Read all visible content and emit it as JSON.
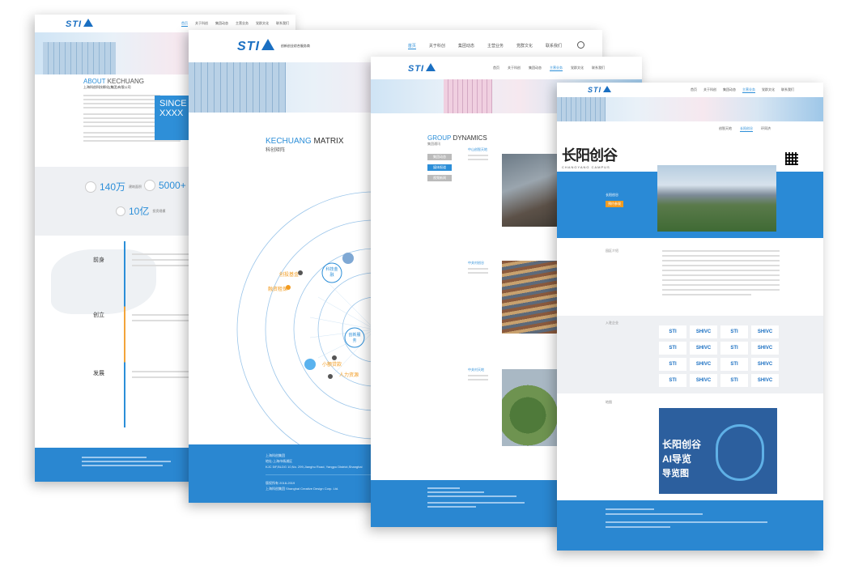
{
  "page1": {
    "logo": "STI",
    "nav": [
      "首页",
      "关于科创",
      "集团动态",
      "主营业务",
      "党群文化",
      "联系我们"
    ],
    "about_title": "ABOUT",
    "about_title2": "KECHUANG",
    "about_cn": "上海科创科技孵化(集团)有限公司",
    "since": "SINCE",
    "since_year": "XXXX",
    "stats": [
      {
        "value": "140万",
        "label": "建筑面积"
      },
      {
        "value": "5000+",
        "label": "注册企业"
      },
      {
        "value": "10亿",
        "label": "投资规模"
      }
    ],
    "timeline": [
      "前身",
      "创立",
      "发展"
    ]
  },
  "page2": {
    "logo": "STI",
    "subtitle": "创新创业综合服务商",
    "nav": [
      "首页",
      "关于科创",
      "集团动态",
      "主营业务",
      "党群文化",
      "联系我们"
    ],
    "matrix_title_a": "KECHUANG",
    "matrix_title_b": "MATRIX",
    "matrix_cn": "科创矩阵",
    "nodes": [
      "创投基金",
      "科技金融",
      "融资租保",
      "创新服务",
      "小额贷款",
      "人力资源"
    ],
    "footer": [
      "上海科创集团",
      "地址:上海市杨浦区",
      "KJC 5/F,BLDG 10,No. 299,Jianghu Road, Yangpu District,Shanghai",
      "版权所有 2018-2019",
      "上海科创集团 Shanghai Creative Design Corp. Ltd."
    ]
  },
  "page3": {
    "logo": "STI",
    "nav": [
      "首页",
      "关于科创",
      "集团动态",
      "主营业务",
      "党群文化",
      "联系我们"
    ],
    "group_a": "GROUP",
    "group_b": "DYNAMICS",
    "group_cn": "集团通讯",
    "tabs": [
      "集团动态",
      "媒体报道",
      "视频新闻"
    ],
    "items": [
      "中山创智天地",
      "中关村创谷",
      "中关村天地"
    ]
  },
  "page4": {
    "logo": "STI",
    "nav": [
      "首页",
      "关于科创",
      "集团动态",
      "主营业务",
      "党群文化",
      "联系我们"
    ],
    "subnav": [
      "创智天地",
      "长阳创谷",
      "环同济"
    ],
    "campus": "长阳创谷",
    "campus_en": "CHANGYANG CAMPUS",
    "banner_label": "长阳创谷",
    "banner_btn": "预约参观",
    "intro_label": "园区介绍",
    "partner_label": "入驻企业",
    "map_label": "地图",
    "logos": [
      "STI",
      "SHIVC",
      "STI",
      "SHIVC",
      "STI",
      "SHIVC",
      "STI",
      "SHIVC",
      "STI",
      "SHIVC",
      "STI",
      "SHIVC",
      "STI",
      "SHIVC",
      "STI",
      "SHIVC"
    ],
    "map_title": "长阳创谷",
    "map_sub": "AI导览",
    "map_sub2": "导览图"
  },
  "colors": {
    "brand": "#1a6fc2",
    "footer": "#2a87d1",
    "accent_orange": "#f29b1f"
  }
}
